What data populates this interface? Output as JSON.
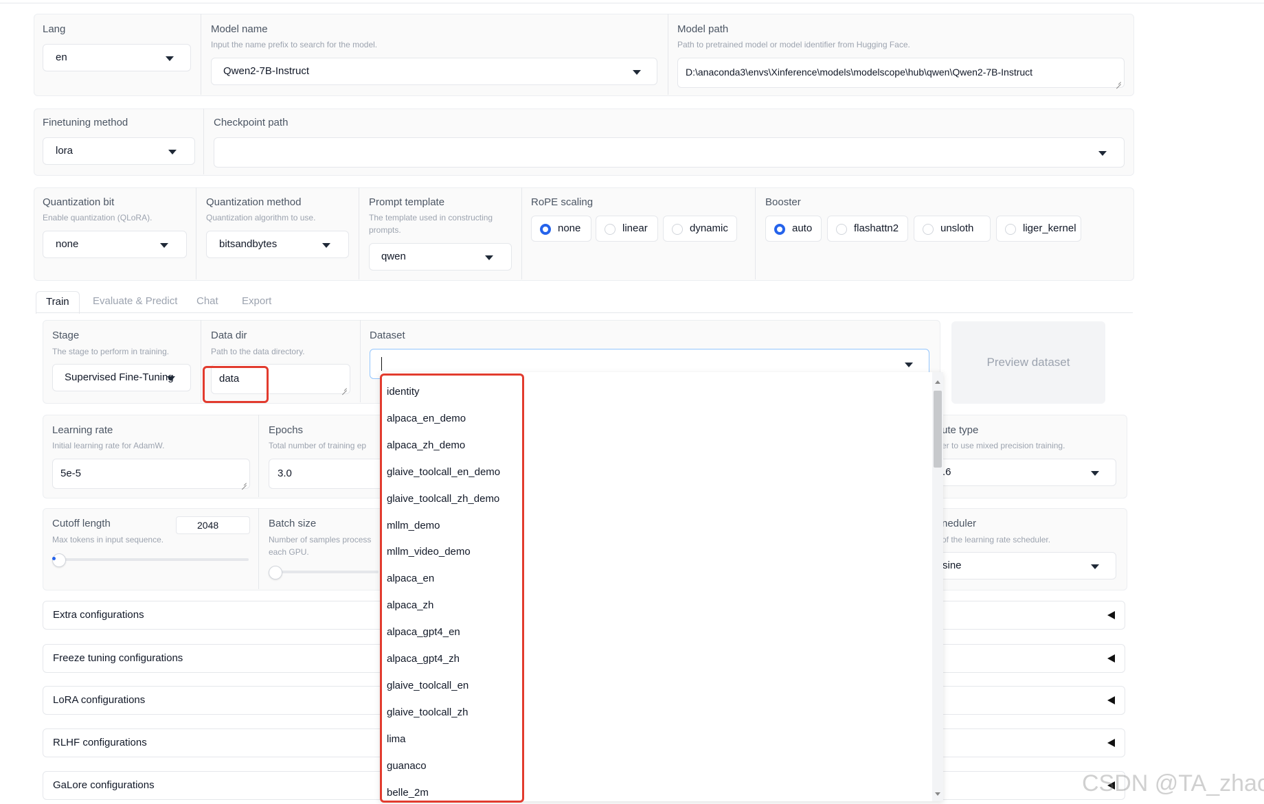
{
  "top": {
    "lang": {
      "label": "Lang",
      "value": "en"
    },
    "model_name": {
      "label": "Model name",
      "hint": "Input the name prefix to search for the model.",
      "value": "Qwen2-7B-Instruct"
    },
    "model_path": {
      "label": "Model path",
      "hint": "Path to pretrained model or model identifier from Hugging Face.",
      "value": "D:\\anaconda3\\envs\\Xinference\\models\\modelscope\\hub\\qwen\\Qwen2-7B-Instruct"
    }
  },
  "row2": {
    "finetuning": {
      "label": "Finetuning method",
      "value": "lora"
    },
    "checkpoint": {
      "label": "Checkpoint path",
      "value": ""
    }
  },
  "row3": {
    "qbit": {
      "label": "Quantization bit",
      "hint": "Enable quantization (QLoRA).",
      "value": "none"
    },
    "qmethod": {
      "label": "Quantization method",
      "hint": "Quantization algorithm to use.",
      "value": "bitsandbytes"
    },
    "prompt": {
      "label": "Prompt template",
      "hint": "The template used in constructing prompts.",
      "value": "qwen"
    },
    "rope": {
      "label": "RoPE scaling",
      "options": [
        "none",
        "linear",
        "dynamic"
      ],
      "selected": "none"
    },
    "booster": {
      "label": "Booster",
      "options": [
        "auto",
        "flashattn2",
        "unsloth",
        "liger_kernel"
      ],
      "selected": "auto"
    }
  },
  "tabs": [
    "Train",
    "Evaluate & Predict",
    "Chat",
    "Export"
  ],
  "active_tab": "Train",
  "train": {
    "stage": {
      "label": "Stage",
      "hint": "The stage to perform in training.",
      "value": "Supervised Fine-Tuning"
    },
    "data_dir": {
      "label": "Data dir",
      "hint": "Path to the data directory.",
      "value": "data"
    },
    "dataset": {
      "label": "Dataset",
      "value": ""
    },
    "preview": "Preview dataset",
    "lr": {
      "label": "Learning rate",
      "hint": "Initial learning rate for AdamW.",
      "value": "5e-5"
    },
    "epochs": {
      "label": "Epochs",
      "hint": "Total number of training ep",
      "value": "3.0"
    },
    "compute": {
      "label": "ute type",
      "hint": "er to use mixed precision training.",
      "value": ".6"
    },
    "cutoff": {
      "label": "Cutoff length",
      "hint": "Max tokens in input sequence.",
      "value": "2048",
      "level": 0.0
    },
    "batch": {
      "label": "Batch size",
      "hint1": "Number of samples process",
      "hint2": "each GPU.",
      "level": 0.0
    },
    "scheduler": {
      "label": "neduler",
      "hint": "of the learning rate scheduler.",
      "value": "sine"
    }
  },
  "accordions": [
    "Extra configurations",
    "Freeze tuning configurations",
    "LoRA configurations",
    "RLHF configurations",
    "GaLore configurations"
  ],
  "dropdown_options": [
    "identity",
    "alpaca_en_demo",
    "alpaca_zh_demo",
    "glaive_toolcall_en_demo",
    "glaive_toolcall_zh_demo",
    "mllm_demo",
    "mllm_video_demo",
    "alpaca_en",
    "alpaca_zh",
    "alpaca_gpt4_en",
    "alpaca_gpt4_zh",
    "glaive_toolcall_en",
    "glaive_toolcall_zh",
    "lima",
    "guanaco",
    "belle_2m"
  ],
  "watermark": "CSDN @TA_zhao",
  "colors": {
    "accent": "#2563eb",
    "highlight": "#e23b2e",
    "panel": "#fafafa"
  }
}
